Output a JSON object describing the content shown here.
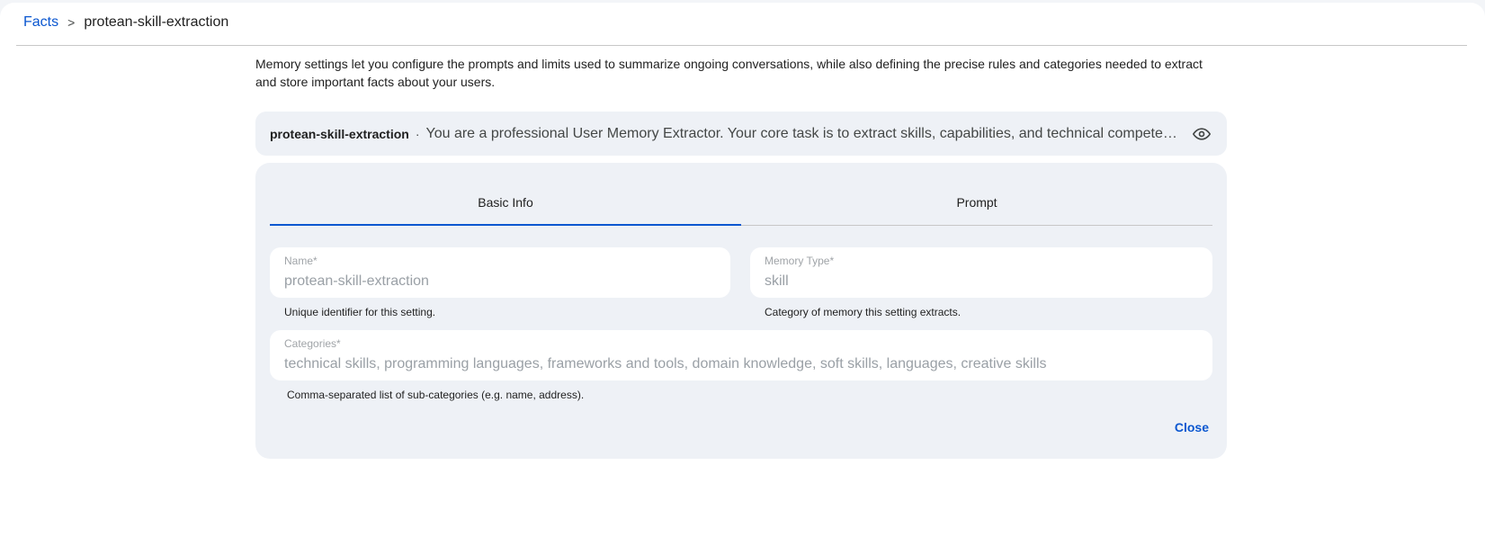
{
  "breadcrumb": {
    "root": "Facts",
    "separator": ">",
    "current": "protean-skill-extraction"
  },
  "description": "Memory settings let you configure the prompts and limits used to summarize ongoing conversations, while also defining the precise rules and categories needed to extract and store important facts about your users.",
  "summary": {
    "name": "protean-skill-extraction",
    "separator": "·",
    "preview": "You are a professional User Memory Extractor. Your core task is to extract skills, capabilities, and technical competencies from conversations.",
    "icon": "eye-icon"
  },
  "tabs": [
    {
      "label": "Basic Info",
      "active": true
    },
    {
      "label": "Prompt",
      "active": false
    }
  ],
  "fields": {
    "name": {
      "label": "Name*",
      "value": "protean-skill-extraction",
      "hint": "Unique identifier for this setting."
    },
    "memory_type": {
      "label": "Memory Type*",
      "value": "skill",
      "hint": "Category of memory this setting extracts."
    },
    "categories": {
      "label": "Categories*",
      "value": "technical skills, programming languages, frameworks and tools, domain knowledge, soft skills, languages, creative skills",
      "hint": "Comma-separated list of sub-categories (e.g. name, address)."
    }
  },
  "actions": {
    "close_label": "Close"
  },
  "colors": {
    "accent": "#0b57d0",
    "panel_bg": "#eef1f6",
    "disabled_text": "#9aa0a6"
  }
}
